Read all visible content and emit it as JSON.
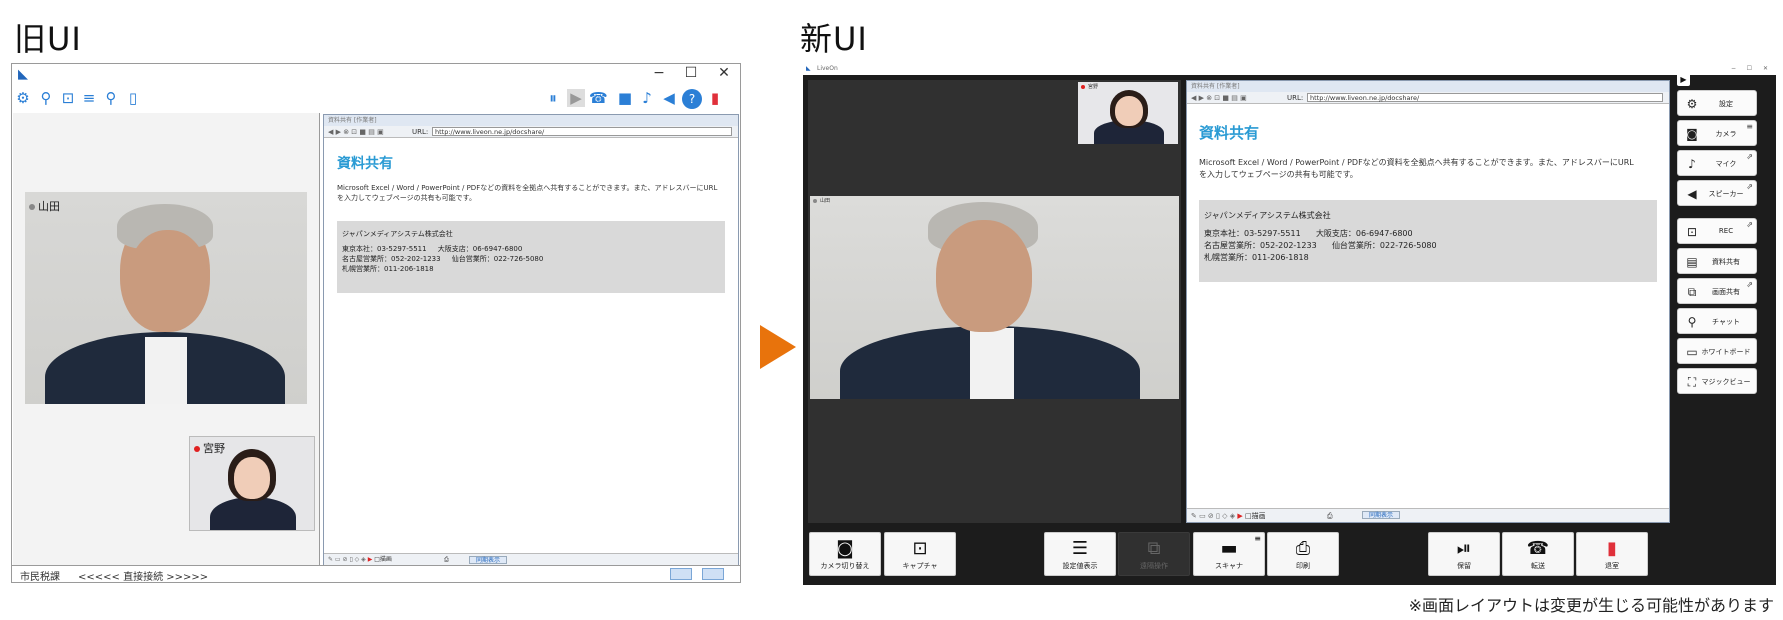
{
  "headings": {
    "old": "旧UI",
    "new": "新UI"
  },
  "note": "※画面レイアウトは変更が生じる可能性があります",
  "old_ui": {
    "window_controls": [
      "−",
      "☐",
      "✕"
    ],
    "participants": {
      "main": "山田",
      "sub": "宮野"
    },
    "status": {
      "left": "市民税課",
      "mid": "<<<<< 直接接続 >>>>>"
    },
    "colors": {
      "icon": "#2b7fd6",
      "accent": "#e8730c",
      "exit": "#e0303a"
    }
  },
  "doc": {
    "window_title": "資料共有 [作業者]",
    "url_label": "URL:",
    "url": "http://www.liveon.ne.jp/docshare/",
    "heading": "資料共有",
    "description_1": "Microsoft Excel / Word / PowerPoint / PDFなどの資料を全拠点へ共有することができます。また、アドレスバーにURL",
    "description_2": "を入力してウェブページの共有も可能です。",
    "company": "ジャパンメディアシステム株式会社",
    "tokyo": "東京本社：03-5297-5511",
    "osaka": "大阪支店：06-6947-6800",
    "nagoya": "名古屋営業所：052-202-1233",
    "sendai": "仙台営業所：022-726-5080",
    "sapporo": "札幌営業所：011-206-1818",
    "draw_label": "□描画",
    "sync_label": "同期表示"
  },
  "new_ui": {
    "app_title": "LiveOn",
    "thumb_name": "宮野",
    "main_name": "山田",
    "side_buttons": [
      {
        "label": "設定",
        "icon": "gear-icon",
        "ext": ""
      },
      {
        "label": "カメラ",
        "icon": "camera-icon",
        "ext": "≡"
      },
      {
        "label": "マイク",
        "icon": "mic-icon",
        "ext": "⇗"
      },
      {
        "label": "スピーカー",
        "icon": "speaker-icon",
        "ext": "⇗"
      },
      {
        "label": "REC",
        "icon": "rec-icon",
        "ext": "⇗"
      },
      {
        "label": "資料共有",
        "icon": "document-icon",
        "ext": ""
      },
      {
        "label": "画面共有",
        "icon": "screen-share-icon",
        "ext": "⇗"
      },
      {
        "label": "チャット",
        "icon": "chat-icon",
        "ext": ""
      },
      {
        "label": "ホワイトボード",
        "icon": "whiteboard-icon",
        "ext": ""
      },
      {
        "label": "マジックビュー",
        "icon": "magic-view-icon",
        "ext": ""
      }
    ],
    "bottom_buttons": {
      "camera_switch": "カメラ切り替え",
      "capture": "キャプチャ",
      "settings_display": "設定値表示",
      "remote_operation": "遠隔操作",
      "scanner": "スキャナ",
      "print": "印刷",
      "hold": "保留",
      "transfer": "転送",
      "exit": "退室"
    },
    "colors": {
      "background": "#1c1c1c",
      "exit_icon": "#e0303a"
    }
  }
}
